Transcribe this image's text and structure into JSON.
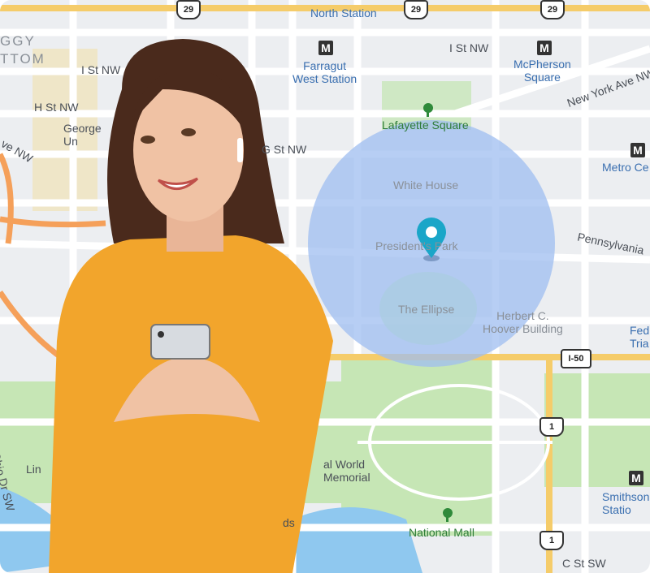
{
  "map": {
    "labels": {
      "foggy_bottom": "GGY\nTTOM",
      "farragut_north": "North Station",
      "farragut_west": "Farragut\nWest Station",
      "i_st_left": "I St NW",
      "i_st_right": "I St NW",
      "h_st": "H St NW",
      "george": "George\nUn",
      "g_st": "G St NW",
      "mcpherson": "McPherson\nSquare",
      "new_york_ave": "New York Ave NW",
      "lafayette": "Lafayette Square",
      "metro_center": "Metro Ce",
      "white_house": "White House",
      "presidents_park": "President's Park",
      "pennsylvania": "Pennsylvania",
      "ellipse": "The Ellipse",
      "hoover": "Herbert C.\nHoover Building",
      "federal_triangle": "Fed\nTria",
      "ohio_dr": "Ohio Dr SW",
      "lincoln": "Lin",
      "ww_memorial": "al World\nMemorial",
      "national_mall": "National Mall",
      "smithsonian": "Smithson\nStatio",
      "c_st": "C St SW",
      "ave_nw": "ve NW",
      "fields": "ds"
    },
    "shields": {
      "r29a": "29",
      "r29b": "29",
      "r29c": "29",
      "i50": "I-50",
      "us1a": "1",
      "us1b": "1"
    },
    "metro_symbol": "M",
    "geofence_color": "#9fbef0",
    "pin_color": "#1aa6c8",
    "icons": [
      "metro-icon",
      "tree-icon",
      "map-pin-icon"
    ]
  },
  "person": {
    "shirt_color": "#f2a52c",
    "hair_color": "#4a2a1c"
  }
}
